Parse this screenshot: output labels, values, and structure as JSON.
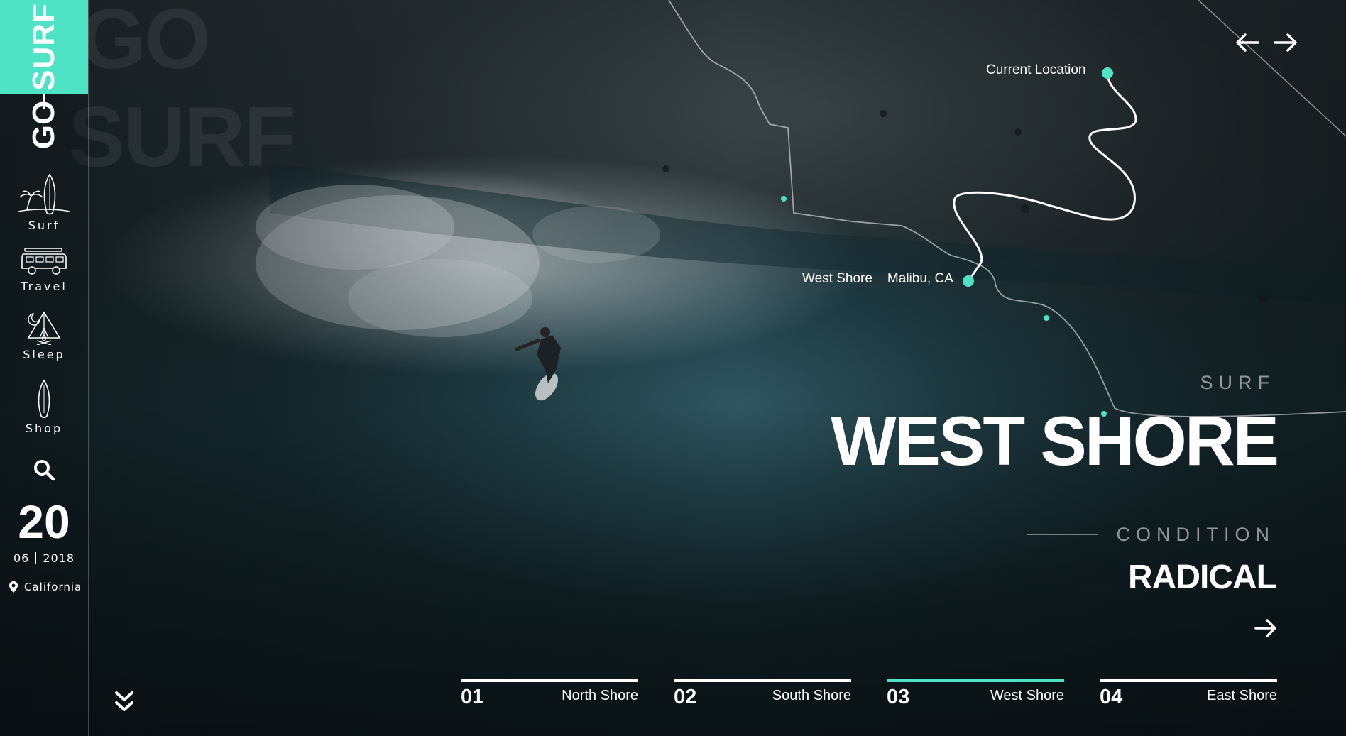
{
  "brand": {
    "word1": "SURF",
    "word2": "GO",
    "ghost_line1": "GO",
    "ghost_line2": "SURF",
    "accent_color": "#4fe3c6"
  },
  "sidebar": {
    "items": [
      {
        "label": "Surf",
        "icon": "surfboard-palm-icon"
      },
      {
        "label": "Travel",
        "icon": "van-icon"
      },
      {
        "label": "Sleep",
        "icon": "tent-icon"
      },
      {
        "label": "Shop",
        "icon": "board-icon"
      }
    ],
    "search_icon": "search-icon",
    "date": {
      "day": "20",
      "month": "06",
      "year": "2018"
    },
    "location": "California",
    "scroll_icon": "double-chevron-down-icon"
  },
  "map": {
    "current_location_label": "Current Location",
    "destination_name": "West Shore",
    "destination_place": "Malibu, CA"
  },
  "nav_arrows": {
    "prev_icon": "arrow-left-icon",
    "next_icon": "arrow-right-icon"
  },
  "hero": {
    "eyebrow": "SURF",
    "title": "WEST SHORE",
    "condition_label": "CONDITION",
    "condition_value": "RADICAL",
    "go_icon": "arrow-right-icon"
  },
  "tabs": [
    {
      "num": "01",
      "name": "North Shore",
      "active": false
    },
    {
      "num": "02",
      "name": "South Shore",
      "active": false
    },
    {
      "num": "03",
      "name": "West Shore",
      "active": true
    },
    {
      "num": "04",
      "name": "East Shore",
      "active": false
    }
  ]
}
